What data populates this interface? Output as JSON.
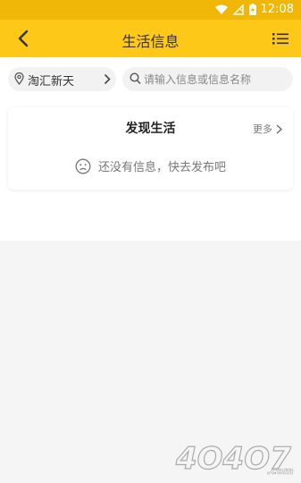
{
  "status": {
    "time": "12:08"
  },
  "header": {
    "title": "生活信息"
  },
  "location": {
    "label": "淘汇新天"
  },
  "search": {
    "placeholder": "请输入信息或信息名称"
  },
  "section": {
    "title": "发现生活",
    "more_label": "更多",
    "empty_text": "还没有信息，快去发布吧"
  },
  "watermark": {
    "text": "4O4O7.com"
  },
  "colors": {
    "accent": "#fec818",
    "status_bar": "#f0b708"
  }
}
